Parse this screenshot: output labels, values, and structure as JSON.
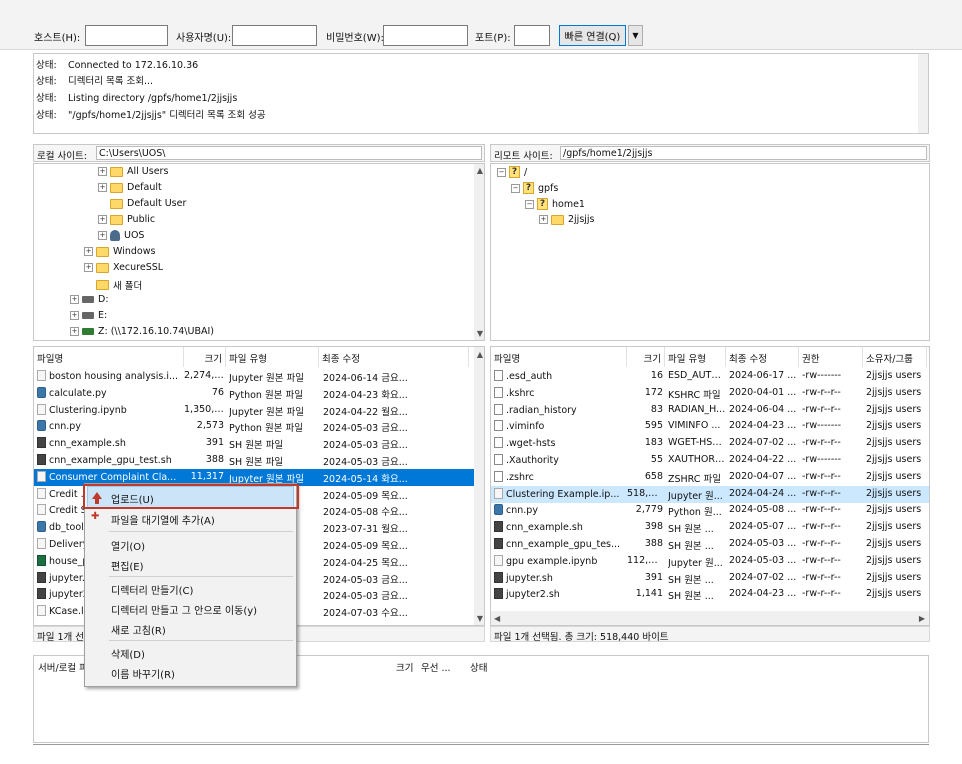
{
  "quickconnect": {
    "host_label": "호스트(H):",
    "host_value": "",
    "user_label": "사용자명(U):",
    "user_value": "",
    "pass_label": "비밀번호(W):",
    "pass_value": "",
    "port_label": "포트(P):",
    "port_value": "",
    "connect_button": "빠른 연결(Q)",
    "dropdown_icon": "chevron-down-icon"
  },
  "log": [
    {
      "label": "상태:",
      "text": "Connected to 172.16.10.36"
    },
    {
      "label": "상태:",
      "text": "디렉터리 목록 조회..."
    },
    {
      "label": "상태:",
      "text": "Listing directory /gpfs/home1/2jjsjjs"
    },
    {
      "label": "상태:",
      "text": "\"/gpfs/home1/2jjsjjs\" 디렉터리 목록 조회 성공"
    }
  ],
  "local": {
    "site_label": "로컬 사이트:",
    "path": "C:\\Users\\UOS\\",
    "tree": [
      {
        "label": "All Users",
        "icon": "folder-icon"
      },
      {
        "label": "Default",
        "icon": "folder-icon"
      },
      {
        "label": "Default User",
        "icon": "folder-icon"
      },
      {
        "label": "Public",
        "icon": "folder-icon"
      },
      {
        "label": "UOS",
        "icon": "user-folder-icon"
      },
      {
        "label": "Windows",
        "icon": "folder-icon"
      },
      {
        "label": "XecureSSL",
        "icon": "folder-icon"
      },
      {
        "label": "새 폴더",
        "icon": "folder-icon"
      },
      {
        "label": "D:",
        "icon": "drive-icon"
      },
      {
        "label": "E:",
        "icon": "drive-icon"
      },
      {
        "label": "Z: (\\\\172.16.10.74\\UBAI)",
        "icon": "network-drive-icon"
      }
    ],
    "columns": [
      "파일명",
      "크기",
      "파일 유형",
      "최종 수정"
    ],
    "files": [
      {
        "name": "boston housing analysis.i...",
        "size": "2,274,019",
        "type": "Jupyter 원본 파일",
        "modified": "2024-06-14 금요...",
        "icon": "notebook"
      },
      {
        "name": "calculate.py",
        "size": "76",
        "type": "Python 원본 파일",
        "modified": "2024-04-23 화요...",
        "icon": "py"
      },
      {
        "name": "Clustering.ipynb",
        "size": "1,350,246",
        "type": "Jupyter 원본 파일",
        "modified": "2024-04-22 월요...",
        "icon": "notebook"
      },
      {
        "name": "cnn.py",
        "size": "2,573",
        "type": "Python 원본 파일",
        "modified": "2024-05-03 금요...",
        "icon": "py"
      },
      {
        "name": "cnn_example.sh",
        "size": "391",
        "type": "SH 원본 파일",
        "modified": "2024-05-03 금요...",
        "icon": "sh"
      },
      {
        "name": "cnn_example_gpu_test.sh",
        "size": "388",
        "type": "SH 원본 파일",
        "modified": "2024-05-03 금요...",
        "icon": "sh"
      },
      {
        "name": "Consumer Complaint Cla...",
        "size": "11,317",
        "type": "Jupyter 원본 파일",
        "modified": "2024-05-14 화요...",
        "icon": "notebook"
      },
      {
        "name": "Credit ...",
        "size": "",
        "type": "",
        "modified": "2024-05-09 목요...",
        "icon": "notebook"
      },
      {
        "name": "Credit S...",
        "size": "",
        "type": "",
        "modified": "2024-05-08 수요...",
        "icon": "notebook"
      },
      {
        "name": "db_tools",
        "size": "",
        "type": "",
        "modified": "2023-07-31 월요...",
        "icon": "py"
      },
      {
        "name": "Delivery",
        "size": "",
        "type": "",
        "modified": "2024-05-09 목요...",
        "icon": "notebook"
      },
      {
        "name": "house_p...",
        "size": "",
        "type": "",
        "modified": "2024-04-25 목요...",
        "icon": "xl"
      },
      {
        "name": "jupyter.s...",
        "size": "",
        "type": "",
        "modified": "2024-05-03 금요...",
        "icon": "sh"
      },
      {
        "name": "jupyter2...",
        "size": "",
        "type": "",
        "modified": "2024-05-03 금요...",
        "icon": "sh"
      },
      {
        "name": "KCase.lo...",
        "size": "",
        "type": "",
        "modified": "2024-07-03 수요...",
        "icon": "notebook"
      }
    ],
    "status": "파일 1개 선"
  },
  "remote": {
    "site_label": "리모트 사이트:",
    "path": "/gpfs/home1/2jjsjjs",
    "tree": [
      {
        "label": "/",
        "icon": "unknown-folder-icon"
      },
      {
        "label": "gpfs",
        "icon": "unknown-folder-icon"
      },
      {
        "label": "home1",
        "icon": "unknown-folder-icon"
      },
      {
        "label": "2jjsjjs",
        "icon": "folder-icon"
      }
    ],
    "columns": [
      "파일명",
      "크기",
      "파일 유형",
      "최종 수정",
      "권한",
      "소유자/그룹"
    ],
    "files": [
      {
        "name": ".esd_auth",
        "size": "16",
        "type": "ESD_AUTH...",
        "modified": "2024-06-17 ...",
        "perm": "-rw-------",
        "owner": "2jjsjjs users",
        "icon": "file"
      },
      {
        "name": ".kshrc",
        "size": "172",
        "type": "KSHRC 파일",
        "modified": "2020-04-01 ...",
        "perm": "-rw-r--r--",
        "owner": "2jjsjjs users",
        "icon": "file"
      },
      {
        "name": ".radian_history",
        "size": "83",
        "type": "RADIAN_H...",
        "modified": "2024-06-04 ...",
        "perm": "-rw-r--r--",
        "owner": "2jjsjjs users",
        "icon": "file"
      },
      {
        "name": ".viminfo",
        "size": "595",
        "type": "VIMINFO ...",
        "modified": "2024-04-23 ...",
        "perm": "-rw-------",
        "owner": "2jjsjjs users",
        "icon": "file"
      },
      {
        "name": ".wget-hsts",
        "size": "183",
        "type": "WGET-HST...",
        "modified": "2024-07-02 ...",
        "perm": "-rw-r--r--",
        "owner": "2jjsjjs users",
        "icon": "file"
      },
      {
        "name": ".Xauthority",
        "size": "55",
        "type": "XAUTHORI...",
        "modified": "2024-04-22 ...",
        "perm": "-rw-------",
        "owner": "2jjsjjs users",
        "icon": "file"
      },
      {
        "name": ".zshrc",
        "size": "658",
        "type": "ZSHRC 파일",
        "modified": "2020-04-07 ...",
        "perm": "-rw-r--r--",
        "owner": "2jjsjjs users",
        "icon": "file"
      },
      {
        "name": "Clustering Example.ip...",
        "size": "518,440",
        "type": "Jupyter 원...",
        "modified": "2024-04-24 ...",
        "perm": "-rw-r--r--",
        "owner": "2jjsjjs users",
        "icon": "notebook"
      },
      {
        "name": "cnn.py",
        "size": "2,779",
        "type": "Python 원...",
        "modified": "2024-05-08 ...",
        "perm": "-rw-r--r--",
        "owner": "2jjsjjs users",
        "icon": "py"
      },
      {
        "name": "cnn_example.sh",
        "size": "398",
        "type": "SH 원본 ...",
        "modified": "2024-05-07 ...",
        "perm": "-rw-r--r--",
        "owner": "2jjsjjs users",
        "icon": "sh"
      },
      {
        "name": "cnn_example_gpu_tes...",
        "size": "388",
        "type": "SH 원본 ...",
        "modified": "2024-05-03 ...",
        "perm": "-rw-r--r--",
        "owner": "2jjsjjs users",
        "icon": "sh"
      },
      {
        "name": "gpu example.ipynb",
        "size": "112,756",
        "type": "Jupyter 원...",
        "modified": "2024-05-03 ...",
        "perm": "-rw-r--r--",
        "owner": "2jjsjjs users",
        "icon": "notebook"
      },
      {
        "name": "jupyter.sh",
        "size": "391",
        "type": "SH 원본 ...",
        "modified": "2024-07-02 ...",
        "perm": "-rw-r--r--",
        "owner": "2jjsjjs users",
        "icon": "sh"
      },
      {
        "name": "jupyter2.sh",
        "size": "1,141",
        "type": "SH 원본 ...",
        "modified": "2024-04-23 ...",
        "perm": "-rw-r--r--",
        "owner": "2jjsjjs users",
        "icon": "sh"
      }
    ],
    "status": "파일 1개 선택됨. 총 크기: 518,440 바이트"
  },
  "queue": {
    "col_server": "서버/로컬 파",
    "col_size": "크기",
    "col_priority": "우선 ...",
    "col_status": "상태"
  },
  "context_menu": {
    "upload": "업로드(U)",
    "queue_add": "파일을 대기열에 추가(A)",
    "open": "열기(O)",
    "edit": "편집(E)",
    "mkdir": "디렉터리 만들기(C)",
    "mkdir_enter": "디렉터리 만들고 그 안으로 이동(y)",
    "refresh": "새로 고침(R)",
    "delete": "삭제(D)",
    "rename": "이름 바꾸기(R)"
  },
  "colors": {
    "selection": "#0078d7",
    "highlight": "#cce8ff",
    "outline": "#c0392b"
  }
}
